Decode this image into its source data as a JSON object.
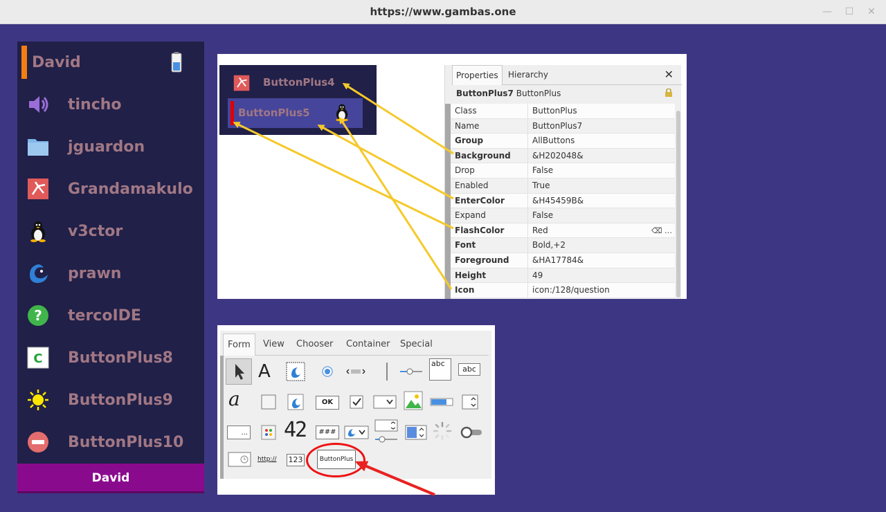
{
  "window": {
    "title": "https://www.gambas.one",
    "minimize": "—",
    "maximize": "☐",
    "close": "✕"
  },
  "sidebar": {
    "items": [
      {
        "label": "David",
        "icon": "battery-icon"
      },
      {
        "label": "tincho",
        "icon": "speaker-icon"
      },
      {
        "label": "jguardon",
        "icon": "folder-icon"
      },
      {
        "label": "Grandamakulo",
        "icon": "pdf-icon"
      },
      {
        "label": "v3ctor",
        "icon": "tux-icon"
      },
      {
        "label": "prawn",
        "icon": "gambas-icon"
      },
      {
        "label": "tercoIDE",
        "icon": "question-icon"
      },
      {
        "label": "ButtonPlus8",
        "icon": "c-file-icon"
      },
      {
        "label": "ButtonPlus9",
        "icon": "sun-icon"
      },
      {
        "label": "ButtonPlus10",
        "icon": "minus-icon"
      }
    ],
    "footer": "David",
    "colors": {
      "background": "#202048",
      "foreground": "#a17784",
      "flash": "#f47e11",
      "footer": "#8a0a8e"
    }
  },
  "demo": {
    "button4": "ButtonPlus4",
    "button5": "ButtonPlus5"
  },
  "properties": {
    "tabs": [
      "Properties",
      "Hierarchy"
    ],
    "close": "✕",
    "selected_name": "ButtonPlus7",
    "selected_class": "ButtonPlus",
    "rows": [
      {
        "name": "Class",
        "value": "ButtonPlus",
        "bold": false
      },
      {
        "name": "Name",
        "value": "ButtonPlus7",
        "bold": false
      },
      {
        "name": "Group",
        "value": "AllButtons",
        "bold": true
      },
      {
        "name": "Background",
        "value": "&H202048&",
        "bold": true
      },
      {
        "name": "Drop",
        "value": "False",
        "bold": false
      },
      {
        "name": "Enabled",
        "value": "True",
        "bold": false
      },
      {
        "name": "EnterColor",
        "value": "&H45459B&",
        "bold": true
      },
      {
        "name": "Expand",
        "value": "False",
        "bold": false
      },
      {
        "name": "FlashColor",
        "value": "Red",
        "bold": true
      },
      {
        "name": "Font",
        "value": "Bold,+2",
        "bold": true
      },
      {
        "name": "Foreground",
        "value": "&HA17784&",
        "bold": true
      },
      {
        "name": "Height",
        "value": "49",
        "bold": true
      },
      {
        "name": "Icon",
        "value": "icon:/128/question",
        "bold": true
      }
    ],
    "edit_glyph": "⌫ …"
  },
  "toolbox": {
    "tabs": [
      "Form",
      "View",
      "Chooser",
      "Container",
      "Special"
    ],
    "labels": {
      "abc1": "abc",
      "abc2": "abc",
      "ok": "OK",
      "digits": "42",
      "hash": "###",
      "dots": "...",
      "http": "http://",
      "num": "123",
      "buttonplus": "ButtonPlus",
      "label_a": "A",
      "text_a": "a"
    }
  }
}
